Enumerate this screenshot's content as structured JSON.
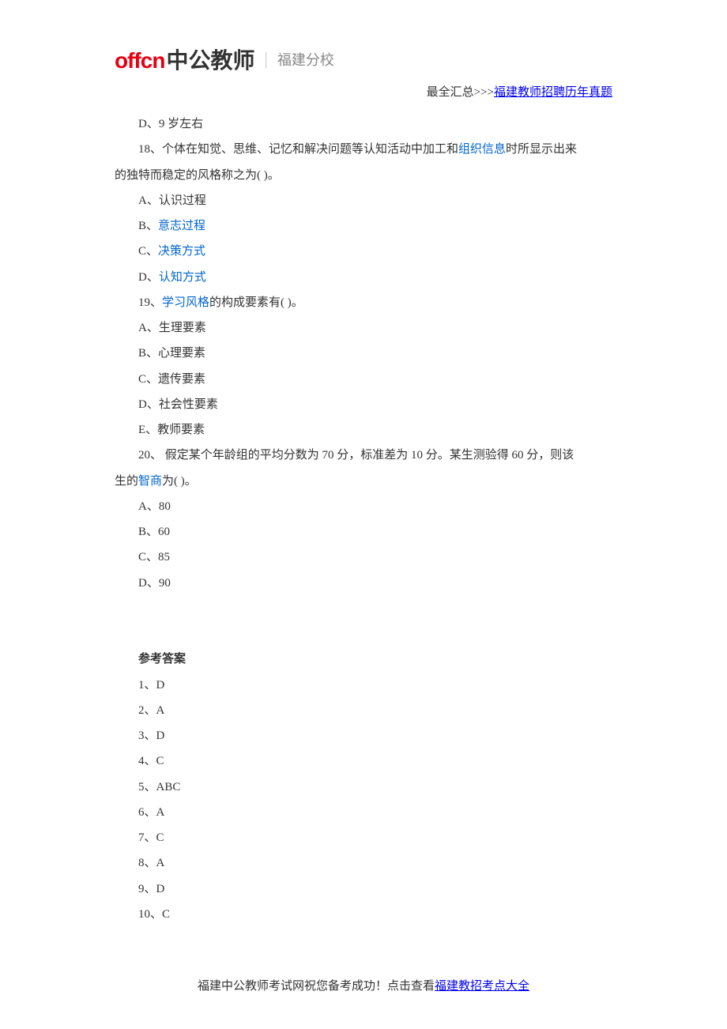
{
  "header": {
    "logo_latin": "offcn",
    "logo_chinese": "中公教师",
    "branch": "福建分校",
    "summary_prefix": "最全汇总>>>",
    "summary_link": "福建教师招聘历年真题"
  },
  "body": {
    "q17_d": "D、9 岁左右",
    "q18_p1_a": "18、个体在知觉、思维、记忆和解决问题等认知活动中加工和",
    "q18_link1": "组织信息",
    "q18_p1_b": "时所显示出来",
    "q18_p2": "的独特而稳定的风格称之为( )。",
    "q18_a": "A、认识过程",
    "q18_b_pre": "B、",
    "q18_b_link": "意志过程",
    "q18_c_pre": "C、",
    "q18_c_link": "决策方式",
    "q18_d_pre": "D、",
    "q18_d_link": "认知方式",
    "q19_pre": "19、",
    "q19_link": "学习风格",
    "q19_post": "的构成要素有( )。",
    "q19_a": "A、生理要素",
    "q19_b": "B、心理要素",
    "q19_c": "C、遗传要素",
    "q19_d": "D、社会性要素",
    "q19_e": "E、教师要素",
    "q20_p1": "20、 假定某个年龄组的平均分数为 70 分，标准差为 10 分。某生测验得 60 分，则该",
    "q20_p2_pre": "生的",
    "q20_p2_link": "智商",
    "q20_p2_post": "为( )。",
    "q20_a": "A、80",
    "q20_b": "B、60",
    "q20_c": "C、85",
    "q20_d": "D、90",
    "answers_heading": "参考答案",
    "ans1": "1、D",
    "ans2": "2、A",
    "ans3": "3、D",
    "ans4": "4、C",
    "ans5": "5、ABC",
    "ans6": "6、A",
    "ans7": "7、C",
    "ans8": "8、A",
    "ans9": "9、D",
    "ans10": "10、C"
  },
  "footer": {
    "text": "福建中公教师考试网祝您备考成功！点击查看",
    "link": "福建教招考点大全"
  }
}
